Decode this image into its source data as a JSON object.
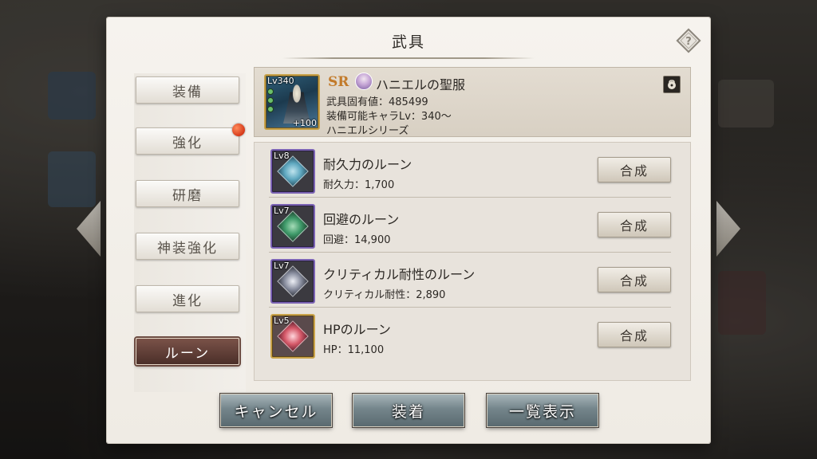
{
  "dialog": {
    "title": "武具"
  },
  "tabs": [
    {
      "label": "装備",
      "active": false,
      "badge": false
    },
    {
      "label": "強化",
      "active": false,
      "badge": true
    },
    {
      "label": "研磨",
      "active": false,
      "badge": false
    },
    {
      "label": "神装強化",
      "active": false,
      "badge": false
    },
    {
      "label": "進化",
      "active": false,
      "badge": false
    },
    {
      "label": "ルーン",
      "active": true,
      "badge": false
    }
  ],
  "equipment": {
    "level": "Lv340",
    "plus": "+100",
    "rarity": "SR",
    "name": "ハニエルの聖服",
    "unique_value": "武具固有値：485499",
    "equip_level": "装備可能キャラLv：340～",
    "series": "ハニエルシリーズ"
  },
  "runes": [
    {
      "level": "Lv8",
      "name": "耐久力のルーン",
      "stat": "耐久力：1,700",
      "button": "合成",
      "gem_color": "#5fa8c0",
      "frame": "purple"
    },
    {
      "level": "Lv7",
      "name": "回避のルーン",
      "stat": "回避：14,900",
      "button": "合成",
      "gem_color": "#3f9a6a",
      "frame": "purple"
    },
    {
      "level": "Lv7",
      "name": "クリティカル耐性のルーン",
      "stat": "クリティカル耐性：2,890",
      "button": "合成",
      "gem_color": "#8a8fa0",
      "frame": "purple"
    },
    {
      "level": "Lv5",
      "name": "HPのルーン",
      "stat": "HP：11,100",
      "button": "合成",
      "gem_color": "#d65a6a",
      "frame": "gold"
    }
  ],
  "buttons": {
    "cancel": "キャンセル",
    "equip": "装着",
    "list": "一覧表示"
  },
  "colors": {
    "accent_active_tab": "#5e3d35",
    "badge": "#d63a1a",
    "rarity": "#c27a2a"
  }
}
